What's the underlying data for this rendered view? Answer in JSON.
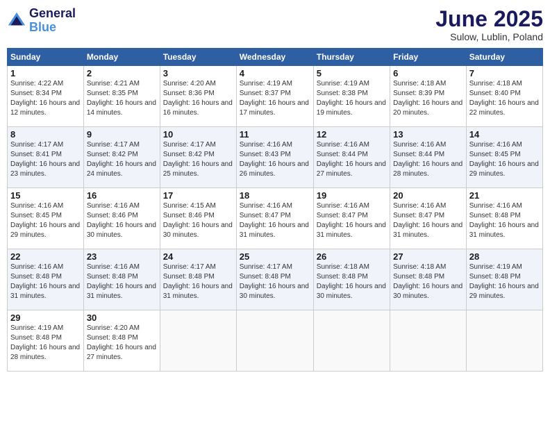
{
  "logo": {
    "line1": "General",
    "line2": "Blue"
  },
  "title": "June 2025",
  "location": "Sulow, Lublin, Poland",
  "days_header": [
    "Sunday",
    "Monday",
    "Tuesday",
    "Wednesday",
    "Thursday",
    "Friday",
    "Saturday"
  ],
  "weeks": [
    [
      {
        "day": "1",
        "sunrise": "4:22 AM",
        "sunset": "8:34 PM",
        "daylight": "16 hours and 12 minutes."
      },
      {
        "day": "2",
        "sunrise": "4:21 AM",
        "sunset": "8:35 PM",
        "daylight": "16 hours and 14 minutes."
      },
      {
        "day": "3",
        "sunrise": "4:20 AM",
        "sunset": "8:36 PM",
        "daylight": "16 hours and 16 minutes."
      },
      {
        "day": "4",
        "sunrise": "4:19 AM",
        "sunset": "8:37 PM",
        "daylight": "16 hours and 17 minutes."
      },
      {
        "day": "5",
        "sunrise": "4:19 AM",
        "sunset": "8:38 PM",
        "daylight": "16 hours and 19 minutes."
      },
      {
        "day": "6",
        "sunrise": "4:18 AM",
        "sunset": "8:39 PM",
        "daylight": "16 hours and 20 minutes."
      },
      {
        "day": "7",
        "sunrise": "4:18 AM",
        "sunset": "8:40 PM",
        "daylight": "16 hours and 22 minutes."
      }
    ],
    [
      {
        "day": "8",
        "sunrise": "4:17 AM",
        "sunset": "8:41 PM",
        "daylight": "16 hours and 23 minutes."
      },
      {
        "day": "9",
        "sunrise": "4:17 AM",
        "sunset": "8:42 PM",
        "daylight": "16 hours and 24 minutes."
      },
      {
        "day": "10",
        "sunrise": "4:17 AM",
        "sunset": "8:42 PM",
        "daylight": "16 hours and 25 minutes."
      },
      {
        "day": "11",
        "sunrise": "4:16 AM",
        "sunset": "8:43 PM",
        "daylight": "16 hours and 26 minutes."
      },
      {
        "day": "12",
        "sunrise": "4:16 AM",
        "sunset": "8:44 PM",
        "daylight": "16 hours and 27 minutes."
      },
      {
        "day": "13",
        "sunrise": "4:16 AM",
        "sunset": "8:44 PM",
        "daylight": "16 hours and 28 minutes."
      },
      {
        "day": "14",
        "sunrise": "4:16 AM",
        "sunset": "8:45 PM",
        "daylight": "16 hours and 29 minutes."
      }
    ],
    [
      {
        "day": "15",
        "sunrise": "4:16 AM",
        "sunset": "8:45 PM",
        "daylight": "16 hours and 29 minutes."
      },
      {
        "day": "16",
        "sunrise": "4:16 AM",
        "sunset": "8:46 PM",
        "daylight": "16 hours and 30 minutes."
      },
      {
        "day": "17",
        "sunrise": "4:15 AM",
        "sunset": "8:46 PM",
        "daylight": "16 hours and 30 minutes."
      },
      {
        "day": "18",
        "sunrise": "4:16 AM",
        "sunset": "8:47 PM",
        "daylight": "16 hours and 31 minutes."
      },
      {
        "day": "19",
        "sunrise": "4:16 AM",
        "sunset": "8:47 PM",
        "daylight": "16 hours and 31 minutes."
      },
      {
        "day": "20",
        "sunrise": "4:16 AM",
        "sunset": "8:47 PM",
        "daylight": "16 hours and 31 minutes."
      },
      {
        "day": "21",
        "sunrise": "4:16 AM",
        "sunset": "8:48 PM",
        "daylight": "16 hours and 31 minutes."
      }
    ],
    [
      {
        "day": "22",
        "sunrise": "4:16 AM",
        "sunset": "8:48 PM",
        "daylight": "16 hours and 31 minutes."
      },
      {
        "day": "23",
        "sunrise": "4:16 AM",
        "sunset": "8:48 PM",
        "daylight": "16 hours and 31 minutes."
      },
      {
        "day": "24",
        "sunrise": "4:17 AM",
        "sunset": "8:48 PM",
        "daylight": "16 hours and 31 minutes."
      },
      {
        "day": "25",
        "sunrise": "4:17 AM",
        "sunset": "8:48 PM",
        "daylight": "16 hours and 30 minutes."
      },
      {
        "day": "26",
        "sunrise": "4:18 AM",
        "sunset": "8:48 PM",
        "daylight": "16 hours and 30 minutes."
      },
      {
        "day": "27",
        "sunrise": "4:18 AM",
        "sunset": "8:48 PM",
        "daylight": "16 hours and 30 minutes."
      },
      {
        "day": "28",
        "sunrise": "4:19 AM",
        "sunset": "8:48 PM",
        "daylight": "16 hours and 29 minutes."
      }
    ],
    [
      {
        "day": "29",
        "sunrise": "4:19 AM",
        "sunset": "8:48 PM",
        "daylight": "16 hours and 28 minutes."
      },
      {
        "day": "30",
        "sunrise": "4:20 AM",
        "sunset": "8:48 PM",
        "daylight": "16 hours and 27 minutes."
      },
      null,
      null,
      null,
      null,
      null
    ]
  ]
}
